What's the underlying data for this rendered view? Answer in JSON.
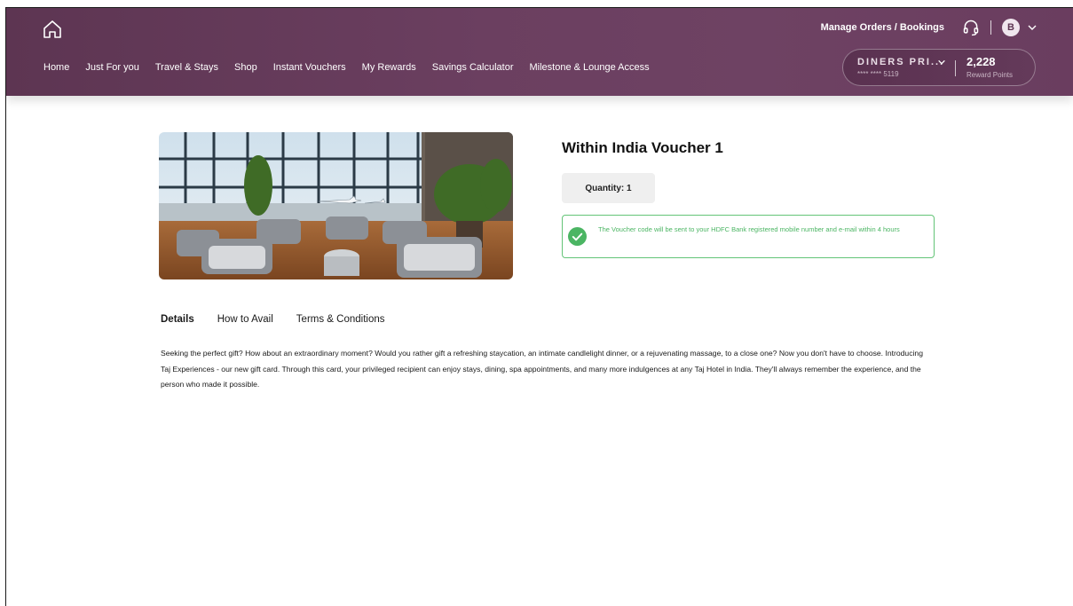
{
  "header": {
    "manage_link": "Manage Orders / Bookings",
    "avatar_initial": "B",
    "nav_items": [
      "Home",
      "Just For you",
      "Travel & Stays",
      "Shop",
      "Instant Vouchers",
      "My Rewards",
      "Savings Calculator",
      "Milestone & Lounge Access"
    ],
    "card": {
      "name": "DINERS PRI...",
      "number": "**** **** 5119",
      "points": "2,228",
      "points_label": "Reward Points"
    }
  },
  "product": {
    "title": "Within India Voucher 1",
    "quantity": "Quantity: 1",
    "notice": "The Voucher code will be sent to your HDFC Bank registered mobile number and e-mail within 4 hours"
  },
  "tabs": [
    "Details",
    "How to Avail",
    "Terms & Conditions"
  ],
  "active_tab": "Details",
  "description": "Seeking the perfect gift? How about an extraordinary moment? Would you rather gift a refreshing staycation, an intimate candlelight dinner, or a rejuvenating massage, to a close one? Now you don't have to choose. Introducing Taj Experiences - our new gift card. Through this card, your privileged recipient can enjoy stays, dining, spa appointments, and many more indulgences at any Taj Hotel in India. They'll always remember the experience, and the person who made it possible.",
  "colors": {
    "header_bg": "#6b3f60",
    "success_green": "#4bb563",
    "quantity_bg": "#efefef"
  },
  "icons": {
    "home": "home-icon",
    "support": "headset-icon",
    "menu": "chevron-down-icon",
    "success": "check-circle-icon"
  }
}
